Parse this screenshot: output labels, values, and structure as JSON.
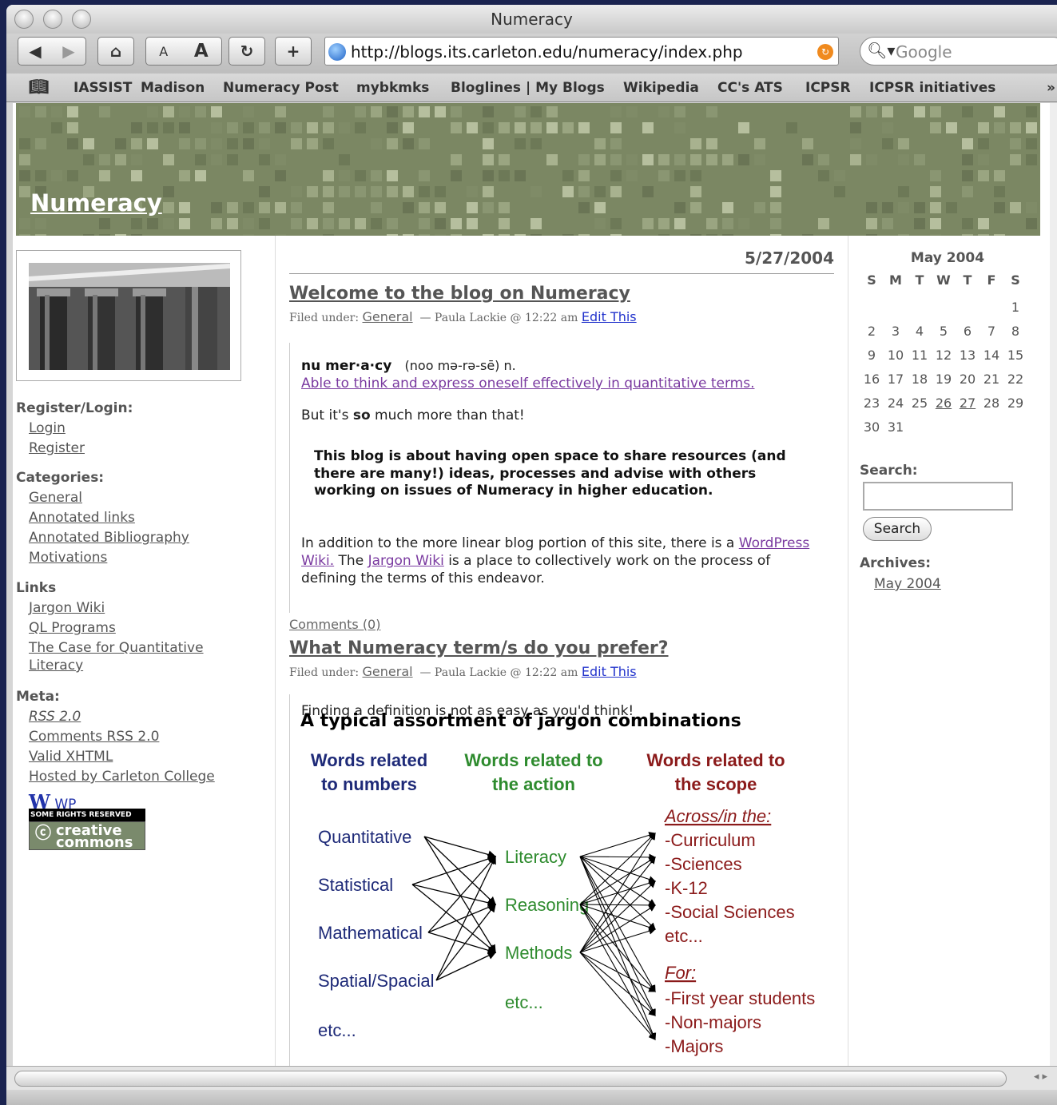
{
  "window": {
    "title": "Numeracy"
  },
  "toolbar": {
    "text_small": "A",
    "text_large": "A",
    "reload": "C",
    "add": "+",
    "url": "http://blogs.its.carleton.edu/numeracy/index.php",
    "search_placeholder": "Google"
  },
  "bookmarks": [
    "IASSIST",
    "Madison",
    "Numeracy Post",
    "mybkmks",
    "Bloglines | My Blogs",
    "Wikipedia",
    "CC's ATS",
    "ICPSR",
    "ICPSR initiatives"
  ],
  "site": {
    "title": "Numeracy"
  },
  "sidebar": {
    "register_heading": "Register/Login:",
    "login": "Login",
    "register": "Register",
    "categories_heading": "Categories:",
    "categories": [
      "General",
      "Annotated links",
      "Annotated Bibliography",
      "Motivations"
    ],
    "links_heading": "Links",
    "links": [
      "Jargon Wiki",
      "QL Programs",
      "The Case for Quantitative",
      "Literacy"
    ],
    "meta_heading": "Meta:",
    "meta": [
      "RSS 2.0",
      "Comments RSS 2.0",
      "Valid XHTML",
      "Hosted by Carleton College"
    ],
    "wp_label": "WP",
    "cc_top": "SOME RIGHTS RESERVED",
    "cc_line1": "creative",
    "cc_line2": "commons"
  },
  "main": {
    "date": "5/27/2004",
    "post1": {
      "title": "Welcome to the blog on Numeracy",
      "filed_prefix": "Filed under:",
      "category": "General",
      "byline": "— Paula Lackie @ 12:22 am",
      "edit": "Edit This",
      "def_word": "nu mer·a·cy",
      "def_pron": "(noo mə-rə-sē) n.",
      "def_text": "Able to think and express oneself effectively in quantitative terms.",
      "p1_a": "But it's ",
      "p1_b": "so",
      "p1_c": " much more than that!",
      "quote": "This blog is about having open space to share resources (and there are many!) ideas, processes and advise with others working on issues of Numeracy in higher education.",
      "p2_a": "In addition to the more linear blog portion of this site, there is a ",
      "p2_link1": "WordPress Wiki.",
      "p2_b": " The ",
      "p2_link2": "Jargon Wiki",
      "p2_c": " is a place to collectively work on the process of defining the terms of this endeavor.",
      "comments": "Comments (0)"
    },
    "post2": {
      "title": "What Numeracy term/s do you prefer?",
      "filed_prefix": "Filed under:",
      "category": "General",
      "byline": "— Paula Lackie @ 12:22 am",
      "edit": "Edit This",
      "p1": "Finding a definition is not as easy as you'd think!"
    }
  },
  "jargon_figure": {
    "title": "A typical assortment of jargon combinations",
    "col1_head": [
      "Words related",
      "to numbers"
    ],
    "col2_head": [
      "Words related to",
      "the action"
    ],
    "col3_head": [
      "Words related to",
      "the scope"
    ],
    "numbers": [
      "Quantitative",
      "Statistical",
      "Mathematical",
      "Spatial/Spacial",
      "etc..."
    ],
    "actions": [
      "Literacy",
      "Reasoning",
      "Methods",
      "etc..."
    ],
    "scope_across_label": "Across/in the:",
    "scope_across": [
      "-Curriculum",
      "-Sciences",
      "-K-12",
      "-Social Sciences",
      "etc..."
    ],
    "scope_for_label": "For:",
    "scope_for": [
      "-First year students",
      "-Non-majors",
      "-Majors"
    ],
    "colors": {
      "numbers": "#1e2a78",
      "actions": "#2e8b2e",
      "scope": "#8b1a1a"
    }
  },
  "calendar": {
    "caption": "May 2004",
    "weekdays": [
      "S",
      "M",
      "T",
      "W",
      "T",
      "F",
      "S"
    ],
    "first_weekday": 6,
    "days": 31,
    "linked_days": [
      26,
      27
    ]
  },
  "right": {
    "search_label": "Search:",
    "search_button": "Search",
    "archives_label": "Archives:",
    "archive_link": "May 2004"
  },
  "colors": {
    "header_bg": "#7b8763",
    "link_purple": "#7a3aa0",
    "edit_blue": "#2233cc"
  }
}
